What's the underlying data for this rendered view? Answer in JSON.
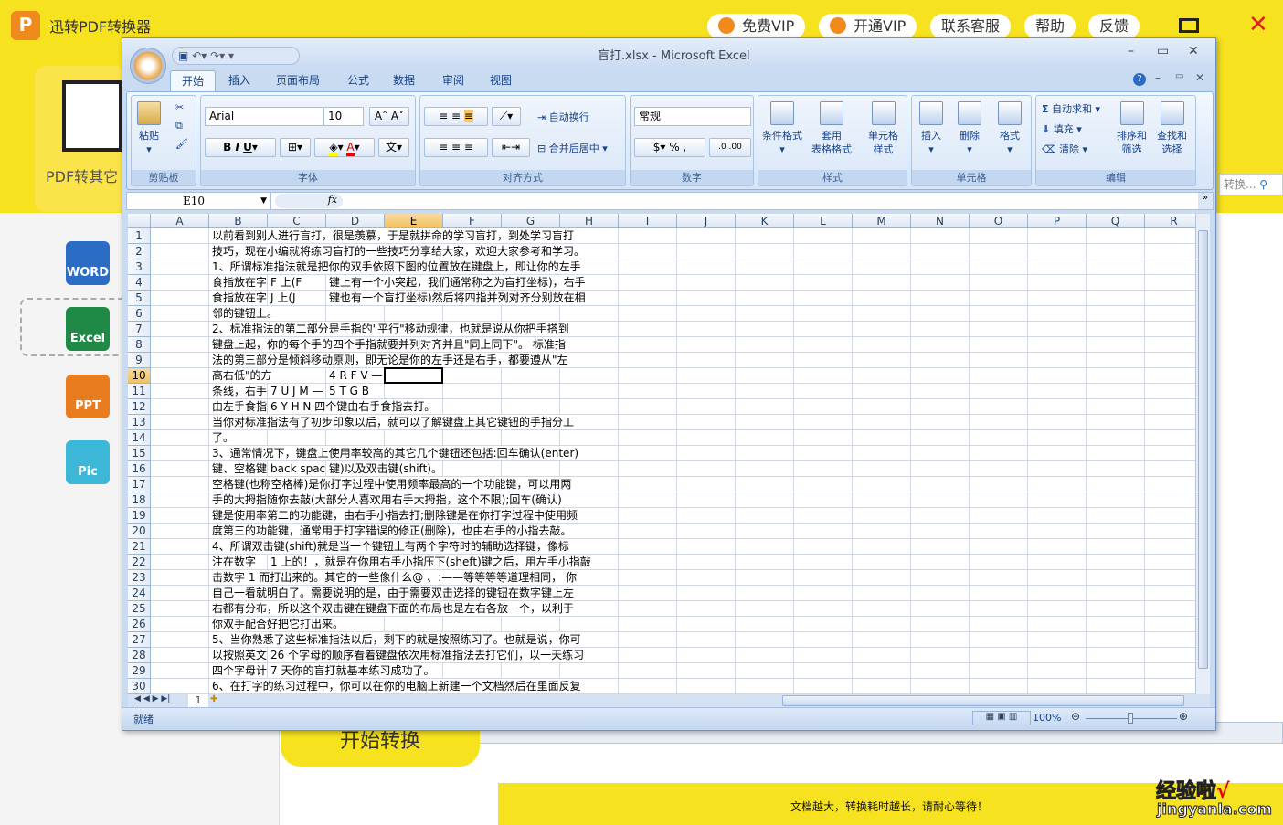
{
  "app": {
    "title": "迅转PDF转换器",
    "logo_text": "P",
    "vip_free": "免费VIP",
    "vip_open": "开通VIP",
    "support": "联系客服",
    "help": "帮助",
    "feedback": "反馈",
    "card_label": "PDF转其它",
    "side_items": [
      {
        "label": "WORD",
        "color": "#2b6cc4"
      },
      {
        "label": "Excel",
        "color": "#1f8a45"
      },
      {
        "label": "PPT",
        "color": "#e87c1e"
      },
      {
        "label": "Pic",
        "color": "#3cb7d8"
      }
    ],
    "start_button": "开始转换",
    "bottom_notice": "文档越大，转换耗时越长，请耐心等待！",
    "watermark_cn": "经验啦",
    "watermark_en": "jingyanla.com",
    "search_placeholder": "转换..."
  },
  "excel": {
    "title": "盲打.xlsx - Microsoft Excel",
    "tabs": [
      "开始",
      "插入",
      "页面布局",
      "公式",
      "数据",
      "审阅",
      "视图"
    ],
    "active_tab": 0,
    "ribbon": {
      "paste": "粘贴",
      "clipboard": "剪贴板",
      "font_name": "Arial",
      "font_size": "10",
      "font_group": "字体",
      "wrap": "自动换行",
      "merge": "合并后居中",
      "align_group": "对齐方式",
      "number_format": "常规",
      "number_group": "数字",
      "cond_format": "条件格式",
      "table_format": "套用\n表格格式",
      "cell_style": "单元格\n样式",
      "style_group": "样式",
      "insert": "插入",
      "delete": "删除",
      "format": "格式",
      "cells_group": "单元格",
      "autosum": "自动求和",
      "fill": "填充",
      "clear": "清除",
      "sort": "排序和\n筛选",
      "find": "查找和\n选择",
      "edit_group": "编辑"
    },
    "name_box": "E10",
    "fx": "fx",
    "columns": [
      "A",
      "B",
      "C",
      "D",
      "E",
      "F",
      "G",
      "H",
      "I",
      "J",
      "K",
      "L",
      "M",
      "N",
      "O",
      "P",
      "Q",
      "R"
    ],
    "selected_col": "E",
    "selected_row": 10,
    "rows": [
      {
        "n": 1,
        "B": "以前看到别人进行盲打，很是羡慕，于是就拼命的学习盲打，到处学习盲打"
      },
      {
        "n": 2,
        "B": "技巧，现在小编就将练习盲打的一些技巧分享给大家，欢迎大家参考和学习。"
      },
      {
        "n": 3,
        "B": "1、所谓标准指法就是把你的双手依照下图的位置放在键盘上，即让你的左手"
      },
      {
        "n": 4,
        "B": "食指放在字",
        "C": "F 上(F",
        "D": "键上有一个小突起，我们通常称之为盲打坐标)，右手"
      },
      {
        "n": 5,
        "B": "食指放在字",
        "C": "J 上(J",
        "D": "键也有一个盲打坐标)然后将四指并列对齐分别放在相"
      },
      {
        "n": 6,
        "B": "邻的键钮上。"
      },
      {
        "n": 7,
        "B": "2、标准指法的第二部分是手指的\"平行\"移动规律，也就是说从你把手搭到"
      },
      {
        "n": 8,
        "B": "键盘上起，你的每个手的四个手指就要并列对齐并且\"同上同下\"。 标准指"
      },
      {
        "n": 9,
        "B": "法的第三部分是倾斜移动原则，即无论是你的左手还是右手，都要遵从\"左"
      },
      {
        "n": 10,
        "B": "高右低\"的方",
        "D": "4 R F V —"
      },
      {
        "n": 11,
        "B": "条线，右手",
        "C": "7 U J M —",
        "D": "5 T G B"
      },
      {
        "n": 12,
        "B": "由左手食指",
        "C": "6 Y H N 四个键由右手食指去打。"
      },
      {
        "n": 13,
        "B": "当你对标准指法有了初步印象以后，就可以了解键盘上其它键钮的手指分工"
      },
      {
        "n": 14,
        "B": "了。"
      },
      {
        "n": 15,
        "B": "3、通常情况下，键盘上使用率较高的其它几个键钮还包括:回车确认(enter)"
      },
      {
        "n": 16,
        "B": "键、空格键",
        "C": "back spac",
        "D": "键)以及双击键(shift)。"
      },
      {
        "n": 17,
        "B": "空格键(也称空格棒)是你打字过程中使用频率最高的一个功能键，可以用两"
      },
      {
        "n": 18,
        "B": "手的大拇指随你去敲(大部分人喜欢用右手大拇指，这个不限);回车(确认)"
      },
      {
        "n": 19,
        "B": "键是使用率第二的功能键，由右手小指去打;删除键是在你打字过程中使用频"
      },
      {
        "n": 20,
        "B": "度第三的功能键，通常用于打字错误的修正(删除)，也由右手的小指去敲。"
      },
      {
        "n": 21,
        "B": "4、所谓双击键(shift)就是当一个键钮上有两个字符时的辅助选择键，像标"
      },
      {
        "n": 22,
        "B": "注在数字",
        "C": "1 上的！，就是在你用右手小指压下(sheft)键之后，用左手小指敲"
      },
      {
        "n": 23,
        "B": "击数字 1 而打出来的。其它的一些像什么@ 、:——等等等等道理相同， 你"
      },
      {
        "n": 24,
        "B": "自己一看就明白了。需要说明的是，由于需要双击选择的键钮在数字键上左"
      },
      {
        "n": 25,
        "B": "右都有分布，所以这个双击键在键盘下面的布局也是左右各放一个，以利于"
      },
      {
        "n": 26,
        "B": "你双手配合好把它打出来。"
      },
      {
        "n": 27,
        "B": "5、当你熟悉了这些标准指法以后，剩下的就是按照练习了。也就是说，你可"
      },
      {
        "n": 28,
        "B": "以按照英文",
        "C": "26 个字母的顺序看着键盘依次用标准指法去打它们，以一天练习"
      },
      {
        "n": 29,
        "B": "四个字母计",
        "C": "7 天你的盲打就基本练习成功了。"
      },
      {
        "n": 30,
        "B": "6、在打字的练习过程中，你可以在你的电脑上新建一个文档然后在里面反复"
      }
    ],
    "sheet_tab": "1",
    "status": "就绪",
    "zoom": "100%"
  }
}
